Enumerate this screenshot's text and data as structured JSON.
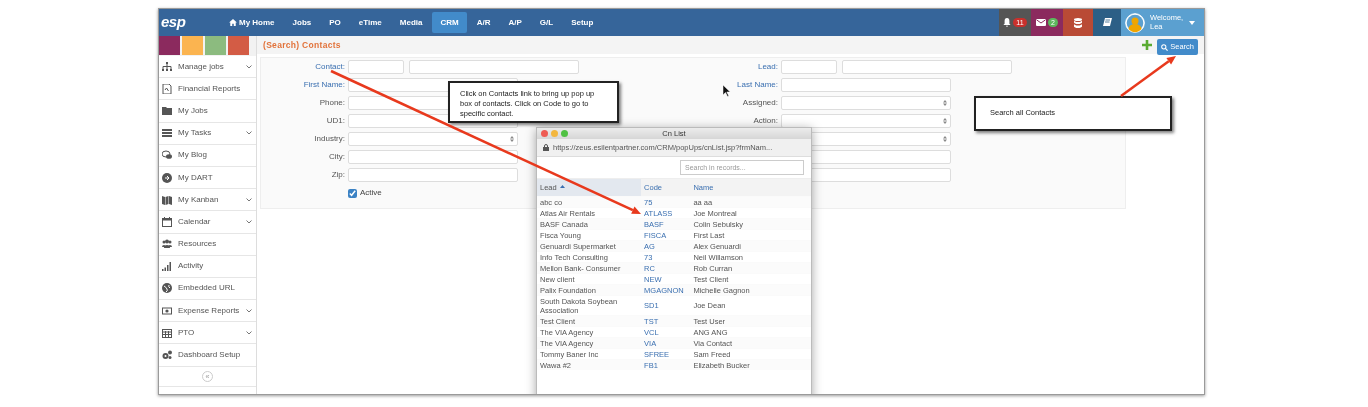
{
  "nav": {
    "logo": "esp",
    "items": [
      {
        "label": "My Home",
        "selected": false
      },
      {
        "label": "Jobs",
        "selected": false
      },
      {
        "label": "PO",
        "selected": false
      },
      {
        "label": "eTime",
        "selected": false
      },
      {
        "label": "Media",
        "selected": false
      },
      {
        "label": "CRM",
        "selected": true
      },
      {
        "label": "A/R",
        "selected": false
      },
      {
        "label": "A/P",
        "selected": false
      },
      {
        "label": "G/L",
        "selected": false
      },
      {
        "label": "Setup",
        "selected": false
      }
    ]
  },
  "notifications": {
    "badge": "11",
    "color": "#c9302c"
  },
  "messages": {
    "badge": "2",
    "color": "#5cb85c"
  },
  "user": {
    "greeting": "Welcome, Lea"
  },
  "color_swatches": [
    {
      "color": "#8b2a5e"
    },
    {
      "color": "#fbb450"
    },
    {
      "color": "#8cbb7f"
    },
    {
      "color": "#d35c45"
    }
  ],
  "sidebar": {
    "items": [
      {
        "label": "Manage jobs",
        "expandable": true
      },
      {
        "label": "Financial Reports",
        "expandable": false
      },
      {
        "label": "My Jobs",
        "expandable": false
      },
      {
        "label": "My Tasks",
        "expandable": true
      },
      {
        "label": "My Blog",
        "expandable": false
      },
      {
        "label": "My DART",
        "expandable": false
      },
      {
        "label": "My Kanban",
        "expandable": true
      },
      {
        "label": "Calendar",
        "expandable": true
      },
      {
        "label": "Resources",
        "expandable": false
      },
      {
        "label": "Activity",
        "expandable": false
      },
      {
        "label": "Embedded URL",
        "expandable": false
      },
      {
        "label": "Expense Reports",
        "expandable": true
      },
      {
        "label": "PTO",
        "expandable": true
      },
      {
        "label": "Dashboard Setup",
        "expandable": false
      }
    ],
    "collapse": "«"
  },
  "page": {
    "title": "(Search) Contacts",
    "search_button": "Search"
  },
  "form": {
    "left": [
      {
        "label": "Contact:",
        "kind": "pair",
        "link": true
      },
      {
        "label": "First Name:",
        "kind": "text",
        "link": true
      },
      {
        "label": "Phone:",
        "kind": "text",
        "link": false
      },
      {
        "label": "UD1:",
        "kind": "text",
        "link": false
      },
      {
        "label": "Industry:",
        "kind": "select",
        "link": false
      },
      {
        "label": "City:",
        "kind": "text",
        "link": false
      },
      {
        "label": "Zip:",
        "kind": "text",
        "link": false
      },
      {
        "label": "Active",
        "kind": "checkbox",
        "checked": true
      }
    ],
    "right": [
      {
        "label": "Lead:",
        "kind": "pair",
        "link": true
      },
      {
        "label": "Last Name:",
        "kind": "text",
        "link": true
      },
      {
        "label": "Assigned:",
        "kind": "select",
        "link": false
      },
      {
        "label": "Action:",
        "kind": "select",
        "link": false
      },
      {
        "kind": "select"
      },
      {
        "kind": "text"
      },
      {
        "kind": "text"
      }
    ]
  },
  "popup": {
    "title": "Cn List",
    "url": "https://zeus.esilentpartner.com/CRM/popUps/cnList.jsp?frmNam...",
    "search_placeholder": "Search in records...",
    "columns": [
      {
        "label": "Lead",
        "sorted": true
      },
      {
        "label": "Code",
        "sorted": false
      },
      {
        "label": "Name",
        "sorted": false
      }
    ],
    "rows": [
      [
        "abc co",
        "75",
        "aa aa"
      ],
      [
        "Atlas Air Rentals",
        "ATLASS",
        "Joe Montreal"
      ],
      [
        "BASF Canada",
        "BASF",
        "Colin Sebulsky"
      ],
      [
        "Fisca Young",
        "FISCA",
        "First Last"
      ],
      [
        "Genuardi Supermarket",
        "AG",
        "Alex Genuardi"
      ],
      [
        "Info Tech Consulting",
        "73",
        "Neil Willamson"
      ],
      [
        "Mellon Bank- Consumer",
        "RC",
        "Rob Curran"
      ],
      [
        "New client",
        "NEW",
        "Test Client"
      ],
      [
        "Palix Foundation",
        "MGAGNON",
        "Michelle Gagnon"
      ],
      [
        "South Dakota Soybean Association",
        "SD1",
        "Joe Dean"
      ],
      [
        "Test Client",
        "TST",
        "Test User"
      ],
      [
        "The VIA Agency",
        "VCL",
        "ANG ANG"
      ],
      [
        "The VIA Agency",
        "VIA",
        "Via Contact"
      ],
      [
        "Tommy Baner Inc",
        "SFREE",
        "Sam Freed"
      ],
      [
        "Wawa #2",
        "FB1",
        "Elizabeth Bucker"
      ]
    ]
  },
  "callouts": [
    {
      "text": "Click on Contacts link to bring up pop up box of contacts. Click on Code to go to specific contact."
    },
    {
      "text": "Search all Contacts"
    }
  ]
}
